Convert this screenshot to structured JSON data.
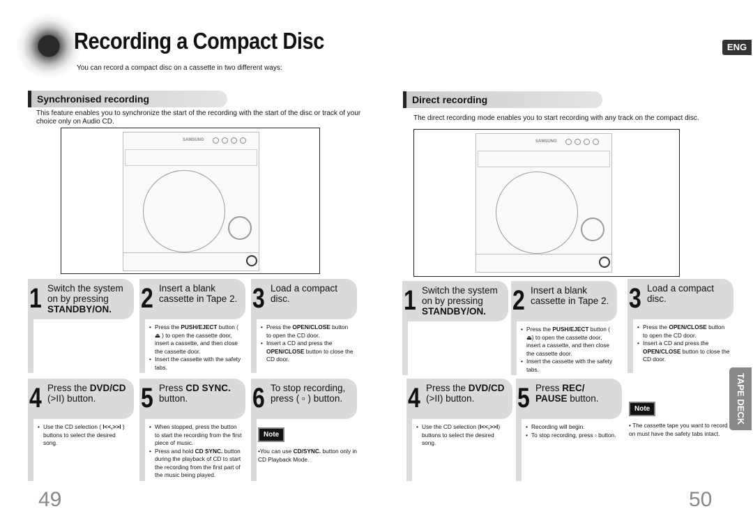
{
  "header": {
    "title": "Recording a Compact Disc",
    "subtitle": "You can record a compact disc on a cassette in two different ways:",
    "lang_badge": "ENG"
  },
  "left": {
    "heading": "Synchronised recording",
    "intro": "This feature enables you to synchronize the start of the recording with the start of the disc or track of your choice only on Audio CD.",
    "device_brand": "SAMSUNG",
    "steps": [
      {
        "num": "1",
        "title": [
          {
            "t": "Switch the system on by pressing "
          },
          {
            "t": "STANDBY/ON.",
            "b": true
          }
        ],
        "bullets": []
      },
      {
        "num": "2",
        "title": [
          {
            "t": "Insert a blank cassette in Tape 2."
          }
        ],
        "bullets": [
          [
            {
              "t": "Press the "
            },
            {
              "t": "PUSH/EJECT",
              "b": true
            },
            {
              "t": " button ( ⏏ ) to open the cassette door, insert a cassette, and then close the cassette door."
            }
          ],
          [
            {
              "t": "Insert the cassette with the safety tabs."
            }
          ]
        ]
      },
      {
        "num": "3",
        "title": [
          {
            "t": "Load a compact disc."
          }
        ],
        "bullets": [
          [
            {
              "t": "Press the "
            },
            {
              "t": "OPEN/CLOSE",
              "b": true
            },
            {
              "t": " button to open the CD door."
            }
          ],
          [
            {
              "t": "Insert a CD and press the "
            },
            {
              "t": "OPEN/CLOSE",
              "b": true
            },
            {
              "t": " button to close the CD door."
            }
          ]
        ]
      },
      {
        "num": "4",
        "title": [
          {
            "t": "Press the "
          },
          {
            "t": "DVD/CD",
            "b": true
          },
          {
            "t": " (>II) button."
          }
        ],
        "bullets": [
          [
            {
              "t": "Use the CD selection ( "
            },
            {
              "t": "I<<,>>I",
              "b": true
            },
            {
              "t": " ) buttons to select the desired song."
            }
          ]
        ]
      },
      {
        "num": "5",
        "title": [
          {
            "t": "Press "
          },
          {
            "t": "CD SYNC.",
            "b": true
          },
          {
            "t": " button."
          }
        ],
        "bullets": [
          [
            {
              "t": "When stopped, press the button to start the recording from the first piece of music."
            }
          ],
          [
            {
              "t": "Press and hold "
            },
            {
              "t": "CD SYNC.",
              "b": true
            },
            {
              "t": " button during the playback of CD to start the recording from the first part of the music being played."
            }
          ]
        ]
      },
      {
        "num": "6",
        "title": [
          {
            "t": "To stop recording, press ( ▫ ) button."
          }
        ],
        "bullets": []
      }
    ],
    "note_label": "Note",
    "note": [
      {
        "t": "•You can use "
      },
      {
        "t": "CD/SYNC.",
        "b": true
      },
      {
        "t": " button only in CD Playback Mode."
      }
    ],
    "page": "49"
  },
  "right": {
    "heading": "Direct recording",
    "intro": "The direct recording mode enables you to start recording with any track on the compact disc.",
    "device_brand": "SAMSUNG",
    "steps": [
      {
        "num": "1",
        "title": [
          {
            "t": "Switch the system on by pressing "
          },
          {
            "t": "STANDBY/ON.",
            "b": true
          }
        ],
        "bullets": []
      },
      {
        "num": "2",
        "title": [
          {
            "t": "Insert a blank cassette in Tape 2."
          }
        ],
        "bullets": [
          [
            {
              "t": "Press the "
            },
            {
              "t": "PUSH/EJECT",
              "b": true
            },
            {
              "t": " button ( ⏏) to open the cassette door, insert a cassette, and then close the cassette door."
            }
          ],
          [
            {
              "t": "Insert the cassette with the safety tabs."
            }
          ]
        ]
      },
      {
        "num": "3",
        "title": [
          {
            "t": "Load a compact disc."
          }
        ],
        "bullets": [
          [
            {
              "t": "Press the "
            },
            {
              "t": "OPEN/CLOSE",
              "b": true
            },
            {
              "t": " button to open the CD door."
            }
          ],
          [
            {
              "t": "Insert a CD and press the "
            },
            {
              "t": "OPEN/CLOSE",
              "b": true
            },
            {
              "t": " button to close the CD door."
            }
          ]
        ]
      },
      {
        "num": "4",
        "title": [
          {
            "t": "Press the "
          },
          {
            "t": "DVD/CD",
            "b": true
          },
          {
            "t": " (>II) button."
          }
        ],
        "bullets": [
          [
            {
              "t": "Use the CD selection ("
            },
            {
              "t": "I<<,>>I",
              "b": true
            },
            {
              "t": ") buttons to select the desired song."
            }
          ]
        ]
      },
      {
        "num": "5",
        "title": [
          {
            "t": "Press "
          },
          {
            "t": "REC/ PAUSE",
            "b": true
          },
          {
            "t": " button."
          }
        ],
        "bullets": [
          [
            {
              "t": "Recording will begin."
            }
          ],
          [
            {
              "t": "To stop recording, press ▫ button."
            }
          ]
        ]
      }
    ],
    "note_label": "Note",
    "note": [
      {
        "t": "• The cassette tape you want to record on must have the safety tabs intact."
      }
    ],
    "page": "50"
  },
  "side_tab": "TAPE DECK"
}
